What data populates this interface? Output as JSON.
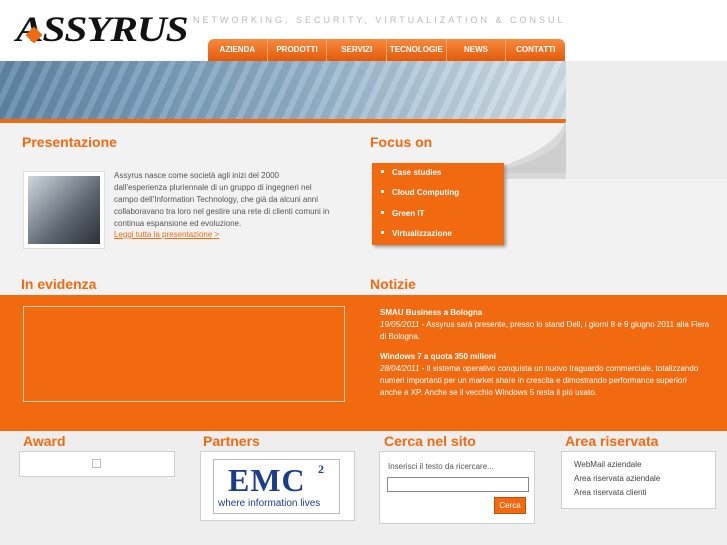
{
  "header": {
    "logo_text": "ASSYRUS",
    "tagline": "NETWORKING, SECURITY, VIRTUALIZATION & CONSULTING SOLUTIONS",
    "nav": [
      "AZIENDA",
      "PRODOTTI",
      "SERVIZI",
      "TECNOLOGIE",
      "NEWS",
      "CONTATTI"
    ]
  },
  "presentazione": {
    "title": "Presentazione",
    "text": "Assyrus nasce come società agli inizi del 2000 dall'esperienza pluriennale di un gruppo di ingegneri nel campo dell'Information Technology, che già da alcuni anni collaboravano tra loro nel gestire una rete di clienti comuni in continua espansione ed evoluzione.",
    "link": "Leggi tutta la presentazione >"
  },
  "focus": {
    "title": "Focus on",
    "items": [
      "Case studies",
      "Cloud Computing",
      "Green IT",
      "Virtualizzazione"
    ]
  },
  "evidenza": {
    "title": "In evidenza"
  },
  "notizie": {
    "title": "Notizie",
    "items": [
      {
        "title": "SMAU Business a Bologna",
        "date": "19/05/2011",
        "body": " - Assyrus sarà presente, presso lo stand Dell, i giorni 8 e 9 giugno 2011 alla Fiera di Bologna."
      },
      {
        "title": "Windows 7 a quota 350 milioni",
        "date": "28/04/2011",
        "body": " - Il sistema operativo conquista un nuovo traguardo commerciale, totalizzando numeri importanti per un market share in crescita e dimostrando performance superiori anche a XP. Anche se il vecchio Windows 5 resta il più usato."
      }
    ]
  },
  "award": {
    "title": "Award"
  },
  "partners": {
    "title": "Partners",
    "emc_word": "EMC",
    "emc_sup": "2",
    "emc_tagline": "where information lives"
  },
  "search": {
    "title": "Cerca nel sito",
    "label": "Inserisci il testo da ricercare...",
    "value": "",
    "button": "Cerca"
  },
  "area": {
    "title": "Area riservata",
    "links": [
      "WebMail aziendale",
      "Area riservata aziendale",
      "Area riservata clienti"
    ]
  },
  "colors": {
    "accent": "#f26a10",
    "emc_blue": "#1a3c8e"
  }
}
